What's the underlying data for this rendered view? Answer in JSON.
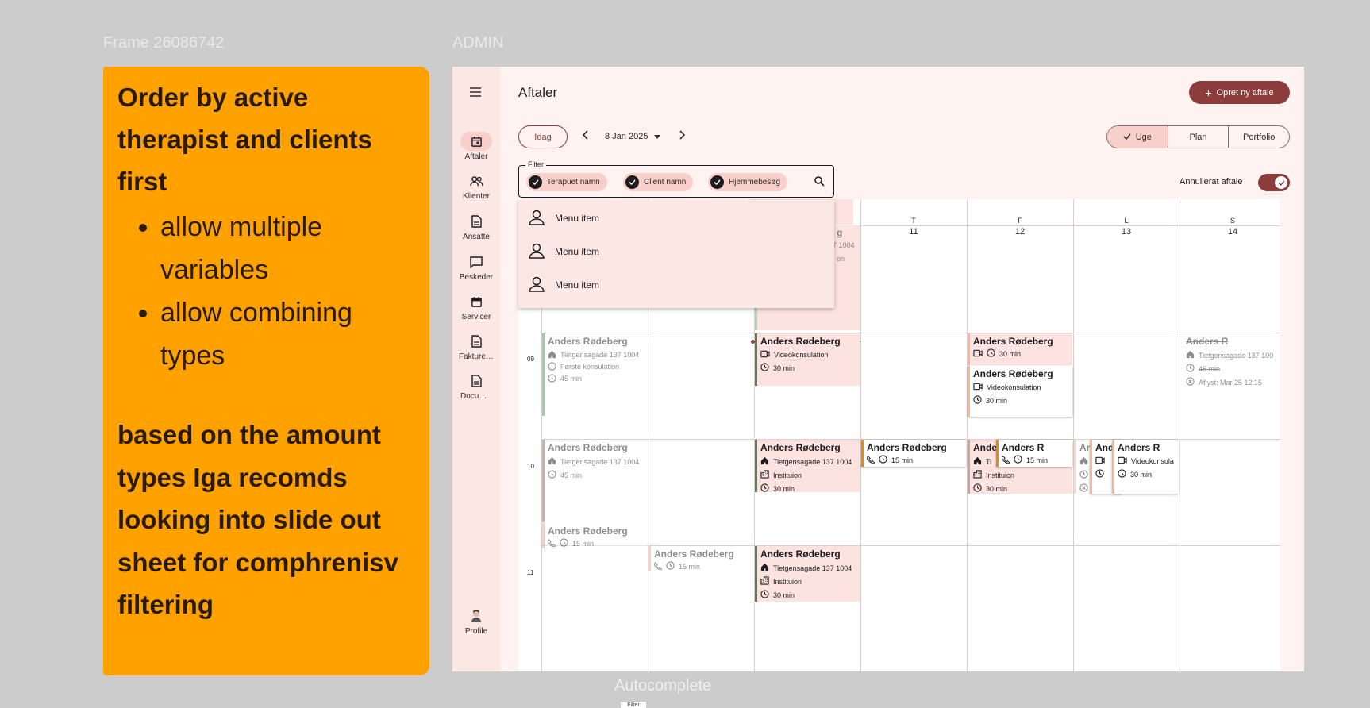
{
  "canvas": {
    "frame_label": "Frame 26086742",
    "admin_label": "ADMIN",
    "autocomplete_label": "Autocomplete",
    "autocomplete_tag": "Filter"
  },
  "note": {
    "heading": "Order by active therapist and clients first",
    "bullets": [
      "allow multiple variables",
      "allow combining types"
    ],
    "body": "based on the amount types Iga recomds looking into slide out sheet for comphrenisv filtering"
  },
  "rail": {
    "menu_icon": "menu-icon",
    "items": [
      {
        "label": "Aftaler",
        "icon": "calendar-icon"
      },
      {
        "label": "Klienter",
        "icon": "people-icon"
      },
      {
        "label": "Ansatte",
        "icon": "document-icon"
      },
      {
        "label": "Beskeder",
        "icon": "chat-icon"
      },
      {
        "label": "Servicer",
        "icon": "calendar-icon"
      },
      {
        "label": "Fakturering",
        "icon": "document-icon"
      },
      {
        "label": "Documents",
        "icon": "document-icon"
      }
    ],
    "profile_label": "Profile"
  },
  "header": {
    "title": "Aftaler",
    "new_button": "Opret ny aftale"
  },
  "toolbar": {
    "today": "Idag",
    "date": "8 Jan 2025",
    "views": [
      "Uge",
      "Plan",
      "Portfolio"
    ],
    "active_view": "Uge"
  },
  "filter": {
    "legend": "Filter",
    "chips": [
      "Terapuet namn",
      "Client namn",
      "Hjemmebesøg"
    ],
    "toggle_label": "Annullerat aftale"
  },
  "menu": {
    "items": [
      "Menu item",
      "Menu item",
      "Menu item"
    ]
  },
  "calendar": {
    "days": [
      {
        "letter": "T",
        "num": "11"
      },
      {
        "letter": "F",
        "num": "12"
      },
      {
        "letter": "L",
        "num": "13"
      },
      {
        "letter": "S",
        "num": "14"
      }
    ],
    "hours": [
      "09",
      "10",
      "11"
    ],
    "partial": {
      "name_tail": "g",
      "addr_tail": "137 1004",
      "tail2": "on"
    },
    "events": {
      "mon9": {
        "name": "Anders Rødeberg",
        "addr": "Tietgensagade 137 1004",
        "type": "Første konsulation",
        "dur": "45 min"
      },
      "mon10": {
        "name": "Anders Rødeberg",
        "addr": "Tietgensagade 137 1004",
        "dur": "45 min"
      },
      "mon11": {
        "name": "Anders Rødeberg",
        "dur": "15 min"
      },
      "tue11": {
        "name": "Anders Rødeberg",
        "dur": "15 min"
      },
      "wed9": {
        "name": "Anders Rødeberg",
        "type": "Videokonsulation",
        "dur": "30 min"
      },
      "wed10": {
        "name": "Anders Rødeberg",
        "addr": "Tietgensagade 137 1004",
        "place": "Instituion",
        "dur": "30 min"
      },
      "wed11": {
        "name": "Anders Rødeberg",
        "addr": "Tietgensagade 137 1004",
        "place": "Instituion",
        "dur": "30 min"
      },
      "thu10": {
        "name": "Anders Rødeberg",
        "dur": "15 min"
      },
      "fri9a": {
        "name": "Anders Rødeberg",
        "dur": "30 min"
      },
      "fri9b": {
        "name": "Anders Rødeberg",
        "type": "Videokonsulation",
        "dur": "30 min"
      },
      "fri10a": {
        "name": "Ande",
        "addr": "Ti",
        "place": "Instituion",
        "dur": "30 min"
      },
      "fri10b": {
        "name": "Anders R",
        "dur": "15 min"
      },
      "sat10a": {
        "name": "An"
      },
      "sat10b": {
        "name": "And"
      },
      "sat10c": {
        "name": "Anders R",
        "type": "Videokonsula",
        "dur": "30 min"
      },
      "sun9": {
        "name": "Anders R",
        "addr": "Tietgensagade 137 100",
        "dur": "45 min",
        "cancel": "Aflyst: Mar 25 12:15"
      }
    }
  },
  "colors": {
    "accent": "#8c3d3b",
    "note_bg": "#ffa200",
    "chip_bg": "#f8cfca",
    "event_bg": "#fde3df",
    "green_bar": "#5a7b55",
    "orange_bar": "#e88a10",
    "peach_bar": "#f4b79a"
  }
}
